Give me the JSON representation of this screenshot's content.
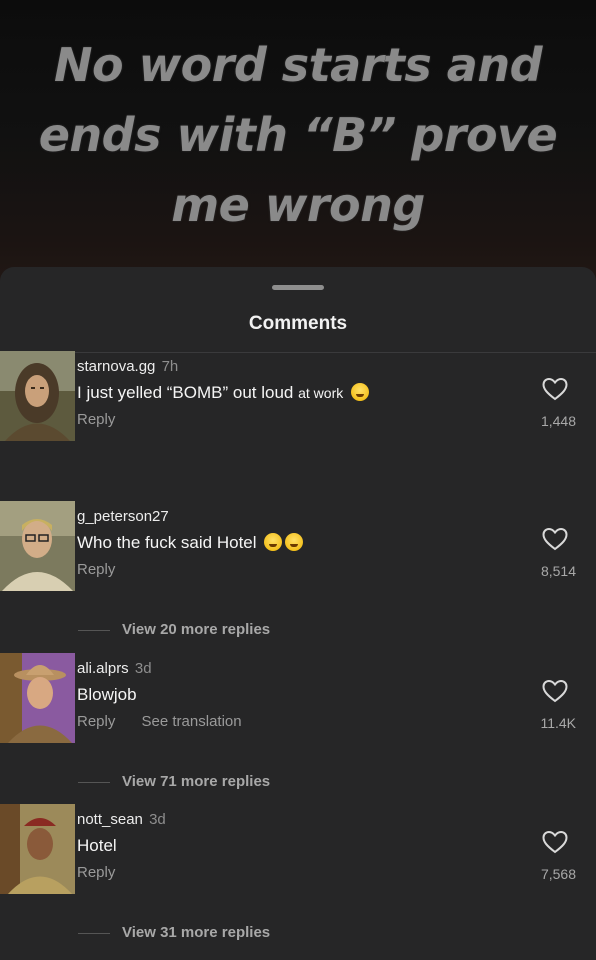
{
  "caption": {
    "line1": "No word starts and",
    "line2": "ends with “B” prove",
    "line3": "me wrong"
  },
  "sheet": {
    "title": "Comments"
  },
  "comments": [
    {
      "username": "starnova.gg",
      "time": "7h",
      "text": "I just yelled “BOMB” out loud",
      "text_small": "at work",
      "reply": "Reply",
      "likes": "1,448",
      "avatar": "woman-hood-avatar"
    },
    {
      "username": "g_peterson27",
      "time": "",
      "text": "Who the fuck said Hotel",
      "reply": "Reply",
      "likes": "8,514",
      "view_replies": "View 20 more replies",
      "avatar": "man-glasses-avatar"
    },
    {
      "username": "ali.alprs",
      "time": "3d",
      "text": "Blowjob",
      "reply": "Reply",
      "translate": "See translation",
      "likes": "11.4K",
      "view_replies": "View 71 more replies",
      "avatar": "cowgirl-avatar"
    },
    {
      "username": "nott_sean",
      "time": "3d",
      "text": "Hotel",
      "reply": "Reply",
      "likes": "7,568",
      "view_replies": "View 31 more replies",
      "avatar": "beret-soldier-avatar"
    }
  ]
}
